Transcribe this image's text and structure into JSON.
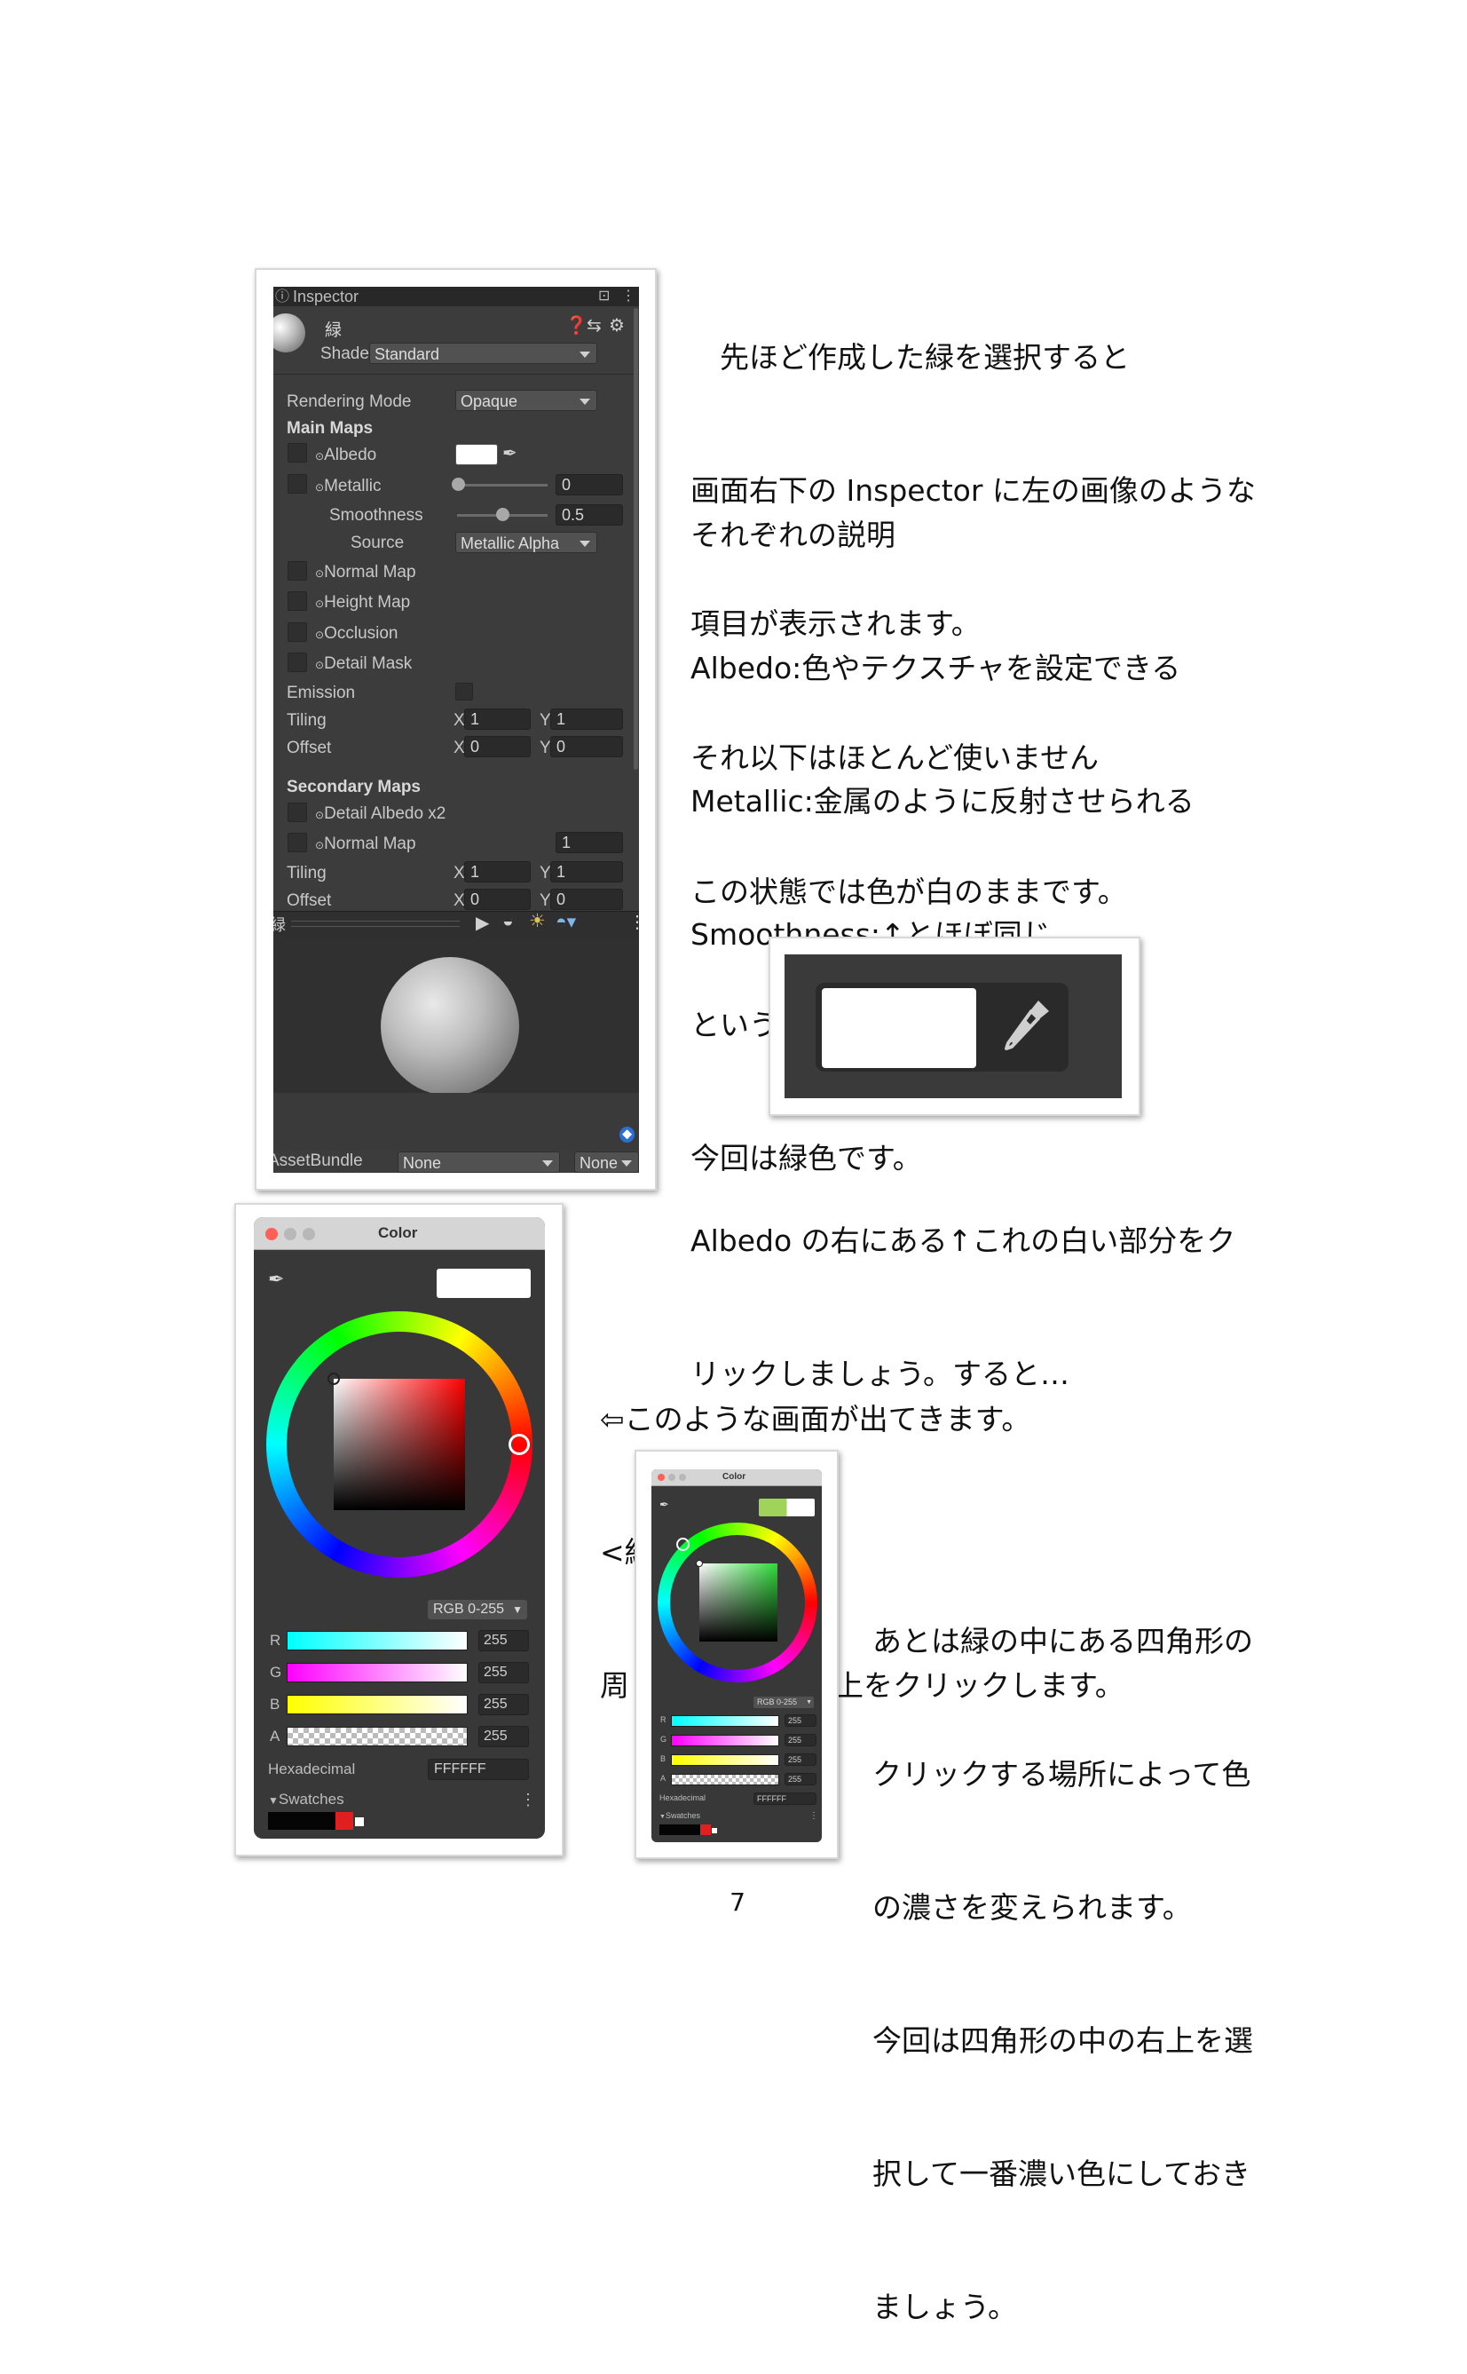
{
  "inspector": {
    "tab_title": "Inspector",
    "material_name": "緑",
    "shader_label": "Shader",
    "shader_value": "Standard",
    "rendering_mode_label": "Rendering Mode",
    "rendering_mode_value": "Opaque",
    "main_maps_label": "Main Maps",
    "albedo_label": "Albedo",
    "metallic_label": "Metallic",
    "metallic_value": "0",
    "smoothness_label": "Smoothness",
    "smoothness_value": "0.5",
    "source_label": "Source",
    "source_value": "Metallic Alpha",
    "normal_map_label": "Normal Map",
    "height_map_label": "Height Map",
    "occlusion_label": "Occlusion",
    "detail_mask_label": "Detail Mask",
    "emission_label": "Emission",
    "tiling_label": "Tiling",
    "offset_label": "Offset",
    "x_label": "X",
    "y_label": "Y",
    "tiling_x": "1",
    "tiling_y": "1",
    "offset_x": "0",
    "offset_y": "0",
    "secondary_maps_label": "Secondary Maps",
    "detail_albedo_label": "Detail Albedo x2",
    "secondary_normal_label": "Normal Map",
    "secondary_normal_value": "1",
    "sec_tiling_x": "1",
    "sec_tiling_y": "1",
    "sec_offset_x": "0",
    "sec_offset_y": "0",
    "preview_name": "緑",
    "assetbundle_label": "AssetBundle",
    "assetbundle_value": "None",
    "assetbundle_variant": "None"
  },
  "text": {
    "p1": [
      "　先ほど作成した緑を選択すると",
      "画面右下の Inspector に左の画像のような",
      "項目が表示されます。"
    ],
    "p2": [
      "それぞれの説明",
      "Albedo:色やテクスチャを設定できる",
      "Metallic:金属のように反射させられる",
      "Smoothness:↑とほぼ同じ"
    ],
    "p3": [
      "それ以下はほとんど使いません"
    ],
    "p4": [
      "この状態では色が白のままです。",
      "ということで色を変えましょう。",
      "今回は緑色です。"
    ],
    "p5": [
      "Albedo の右にある↑これの白い部分をク",
      "リックしましょう。すると…"
    ],
    "p6": [
      "⇦このような画面が出てきます。",
      "<緑を作る場合>",
      "周りにある円の左上をクリックします。"
    ],
    "p7": [
      "あとは緑の中にある四角形の",
      "クリックする場所によって色",
      "の濃さを変えられます。",
      "今回は四角形の中の右上を選",
      "択して一番濃い色にしておき",
      "ましょう。"
    ]
  },
  "color_window": {
    "title": "Color",
    "mode": "RGB 0-255",
    "r_label": "R",
    "g_label": "G",
    "b_label": "B",
    "a_label": "A",
    "r_value": "255",
    "g_value": "255",
    "b_value": "255",
    "a_value": "255",
    "hex_label": "Hexadecimal",
    "hex_value": "FFFFFF",
    "swatches_label": "Swatches"
  },
  "page_number": "7",
  "colors": {
    "swatch_green": "#9fd35a",
    "swatch_red": "#e0201e",
    "close": "#fe5f57"
  }
}
